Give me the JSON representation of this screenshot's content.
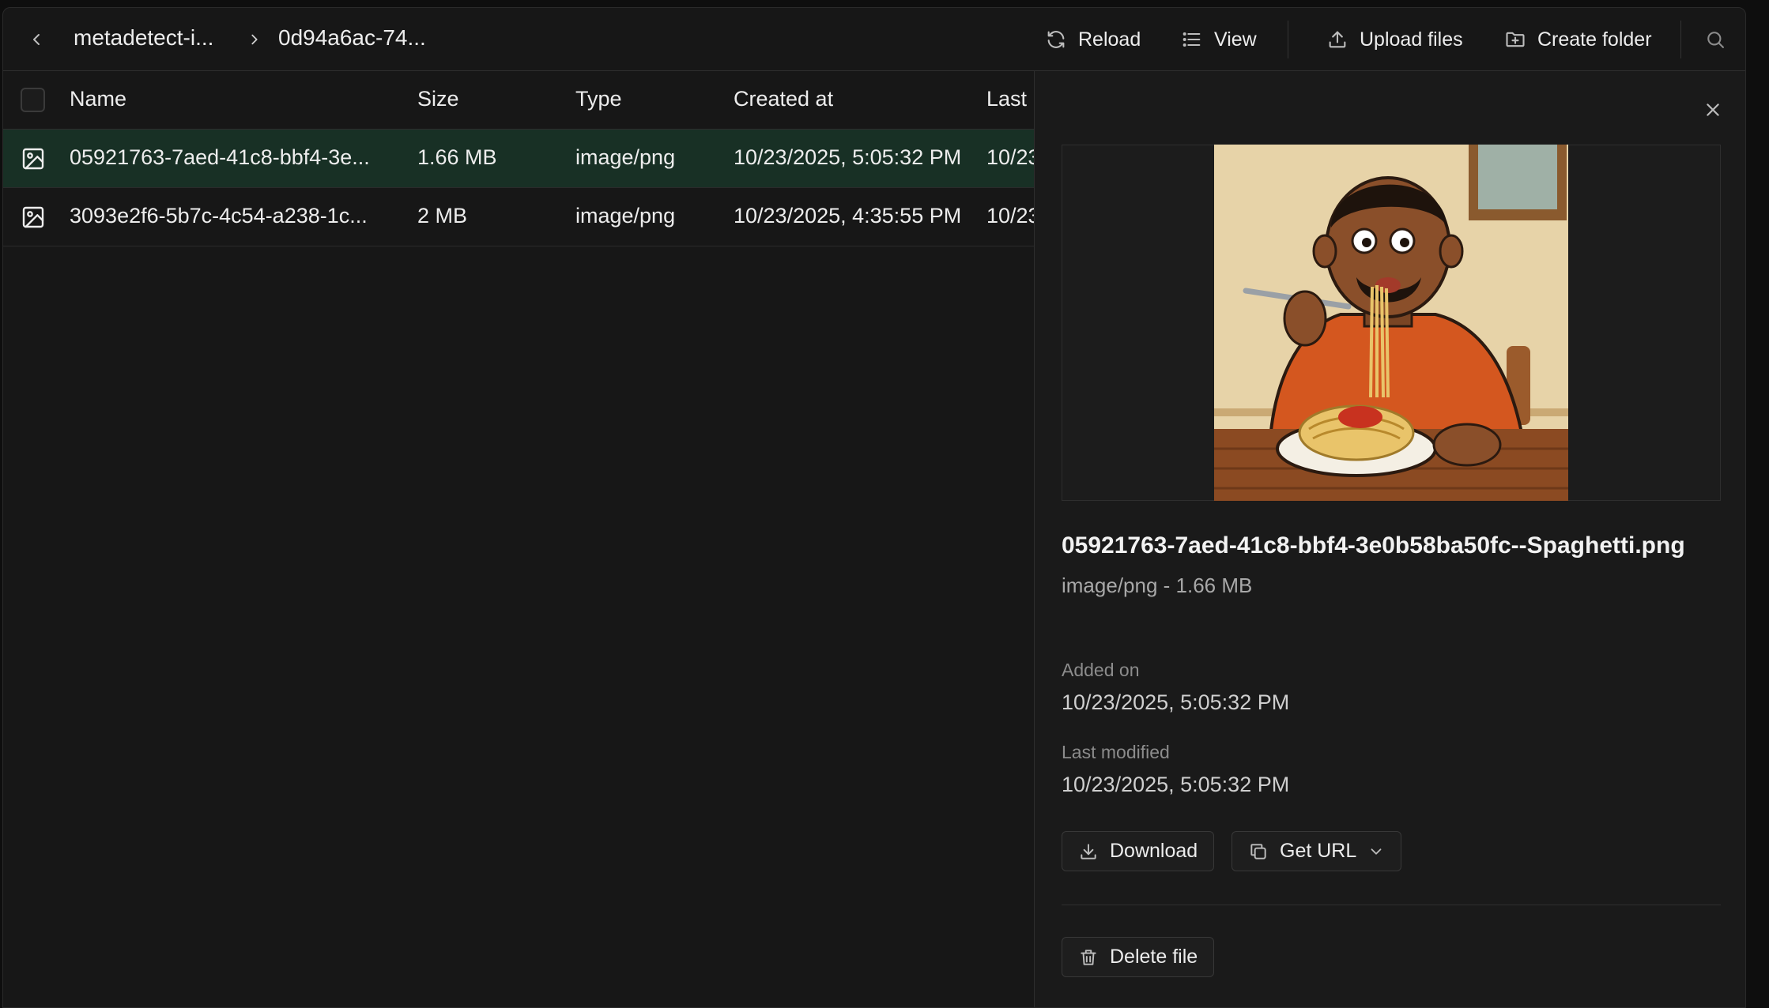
{
  "breadcrumb": {
    "items": [
      "metadetect-i...",
      "0d94a6ac-74..."
    ]
  },
  "toolbar": {
    "reload_label": "Reload",
    "view_label": "View",
    "upload_label": "Upload files",
    "create_folder_label": "Create folder"
  },
  "table": {
    "columns": [
      "Name",
      "Size",
      "Type",
      "Created at",
      "Last"
    ],
    "rows": [
      {
        "name": "05921763-7aed-41c8-bbf4-3e...",
        "size": "1.66 MB",
        "type": "image/png",
        "created": "10/23/2025, 5:05:32 PM",
        "last": "10/23",
        "selected": true
      },
      {
        "name": "3093e2f6-5b7c-4c54-a238-1c...",
        "size": "2 MB",
        "type": "image/png",
        "created": "10/23/2025, 4:35:55 PM",
        "last": "10/23",
        "selected": false
      }
    ]
  },
  "panel": {
    "file_name": "05921763-7aed-41c8-bbf4-3e0b58ba50fc--Spaghetti.png",
    "file_meta": "image/png - 1.66 MB",
    "added_label": "Added on",
    "added_value": "10/23/2025, 5:05:32 PM",
    "modified_label": "Last modified",
    "modified_value": "10/23/2025, 5:05:32 PM",
    "download_label": "Download",
    "get_url_label": "Get URL",
    "delete_label": "Delete file"
  },
  "colors": {
    "background": "#171717",
    "selected_row": "#183025",
    "text": "#ededed",
    "muted": "#8c8c8c"
  }
}
